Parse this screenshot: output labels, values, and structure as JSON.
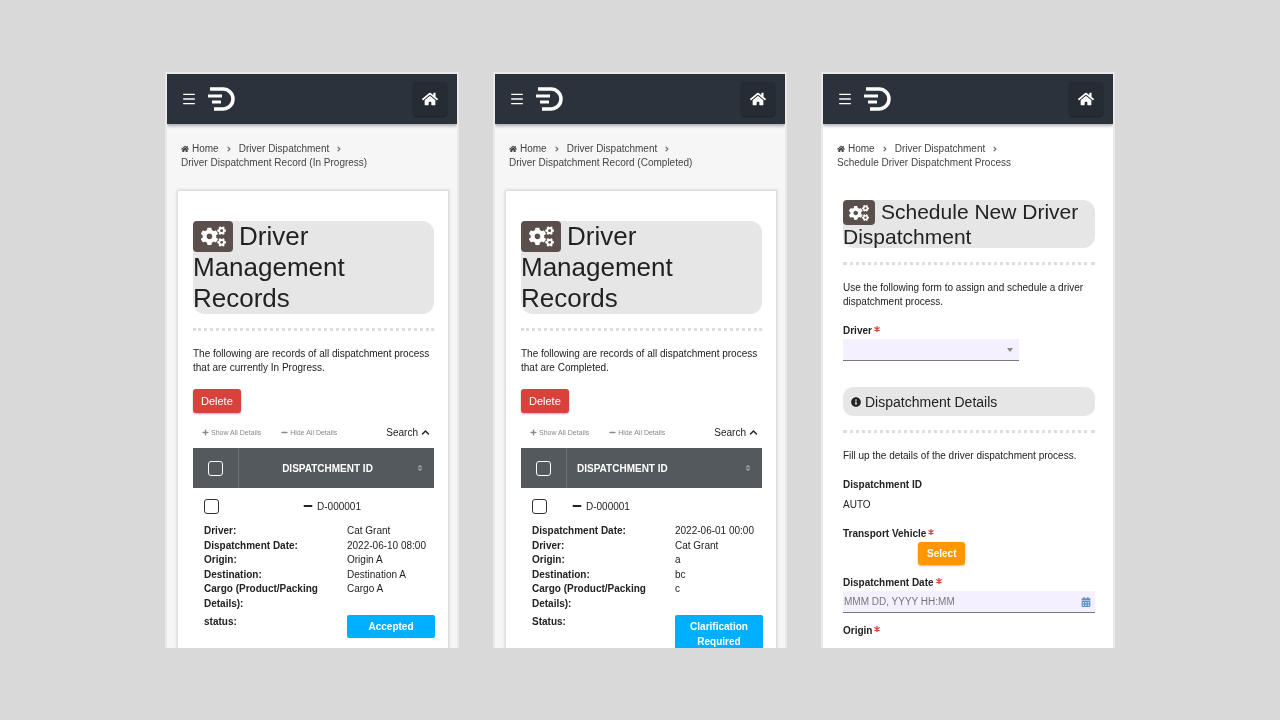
{
  "screens": [
    {
      "kind": "records",
      "breadcrumb": [
        "Home",
        "Driver Dispatchment",
        "Driver Dispatchment Record (In Progress)"
      ],
      "title": "Driver Management Records",
      "intro": "The following are records of all dispatchment process that are currently In Progress.",
      "delete_button": "Delete",
      "show_all": "Show All Details",
      "hide_all": "Hide All Details",
      "search": "Search",
      "column": "DISPATCHMENT ID",
      "column_centered": true,
      "header_checked": false,
      "record": {
        "id": "D-000001",
        "checked": false,
        "expanded": true,
        "fields": [
          {
            "label": "Driver:",
            "value": "Cat Grant"
          },
          {
            "label": "Dispatchment Date:",
            "value": "2022-06-10 08:00"
          },
          {
            "label": "Origin:",
            "value": "Origin A"
          },
          {
            "label": "Destination:",
            "value": "Destination A"
          },
          {
            "label": "Cargo (Product/Packing Details):",
            "value": "Cargo A"
          }
        ],
        "status_label": "status:",
        "status": "Accepted"
      }
    },
    {
      "kind": "records",
      "breadcrumb": [
        "Home",
        "Driver Dispatchment",
        "Driver Dispatchment Record (Completed)"
      ],
      "title": "Driver Management Records",
      "intro": "The following are records of all dispatchment process that are Completed.",
      "delete_button": "Delete",
      "show_all": "Show All Details",
      "hide_all": "Hide All Details",
      "search": "Search",
      "column": "DISPATCHMENT ID",
      "column_centered": false,
      "header_checked": false,
      "record": {
        "id": "D-000001",
        "checked": false,
        "expanded": true,
        "fields": [
          {
            "label": "Dispatchment Date:",
            "value": "2022-06-01 00:00"
          },
          {
            "label": "Driver:",
            "value": "Cat Grant"
          },
          {
            "label": "Origin:",
            "value": "a"
          },
          {
            "label": "Destination:",
            "value": "bc"
          },
          {
            "label": "Cargo (Product/Packing Details):",
            "value": "c"
          }
        ],
        "status_label": "Status:",
        "status": "Clarification Required"
      }
    },
    {
      "kind": "form",
      "breadcrumb": [
        "Home",
        "Driver Dispatchment",
        "Schedule Driver Dispatchment Process"
      ],
      "title": "Schedule New Driver Dispatchment",
      "intro": "Use the following form to assign and schedule a driver dispatchment process.",
      "fields": [
        {
          "kind": "select",
          "label": "Driver",
          "required": true
        },
        {
          "kind": "section",
          "label": "Dispatchment Details",
          "description": "Fill up the details of the driver dispatchment process."
        },
        {
          "kind": "static",
          "label": "Dispatchment ID",
          "value": "AUTO",
          "required": false
        },
        {
          "kind": "button",
          "label": "Transport Vehicle",
          "required": true,
          "button": "Select"
        },
        {
          "kind": "date",
          "label": "Dispatchment Date",
          "required": true,
          "placeholder": "MMM DD, YYYY HH:MM"
        },
        {
          "kind": "label",
          "label": "Origin",
          "required": true
        }
      ]
    }
  ]
}
